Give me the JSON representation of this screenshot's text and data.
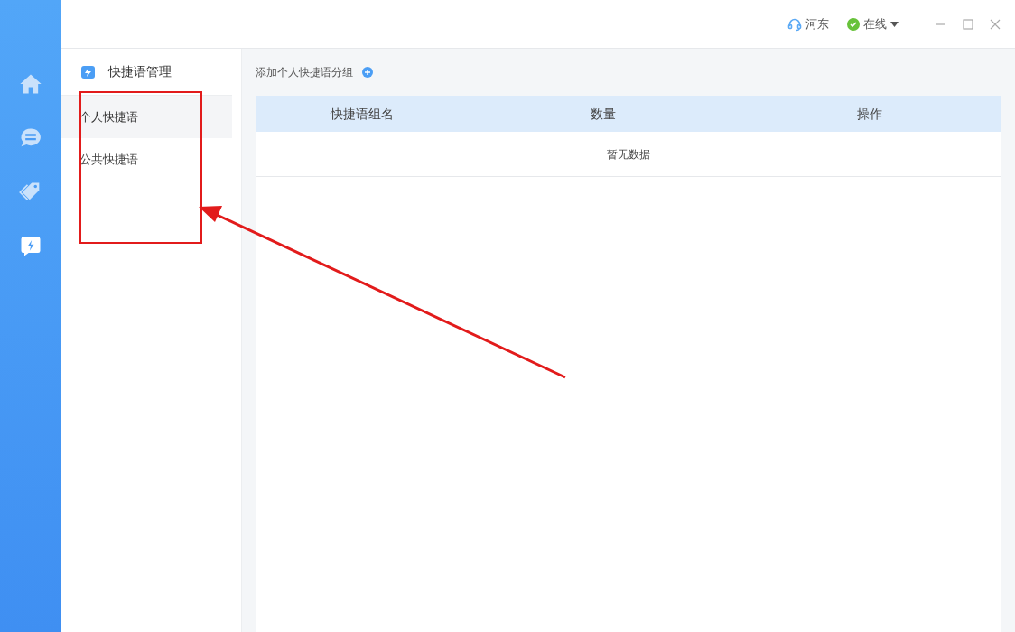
{
  "top_bar": {
    "agent": "河东",
    "status": {
      "label": "在线",
      "online": true
    }
  },
  "nav": [
    {
      "kind": "home",
      "selected": false
    },
    {
      "kind": "chat",
      "selected": false
    },
    {
      "kind": "tag",
      "selected": false
    },
    {
      "kind": "quick",
      "selected": true
    }
  ],
  "panel": {
    "title": "快捷语管理",
    "items": [
      {
        "label": "个人快捷语",
        "selected": true
      },
      {
        "label": "公共快捷语",
        "selected": false
      }
    ]
  },
  "main": {
    "add_label": "添加个人快捷语分组",
    "table": {
      "columns": [
        "快捷语组名",
        "数量",
        "操作"
      ],
      "empty_text": "暂无数据"
    }
  }
}
